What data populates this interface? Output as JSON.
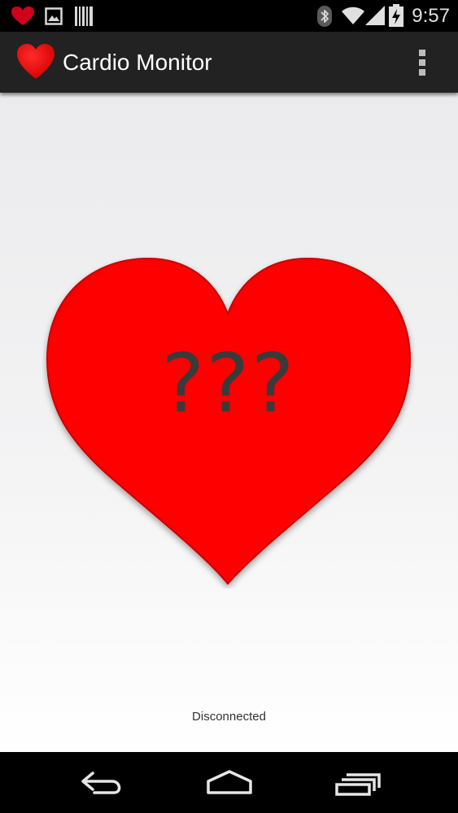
{
  "status_bar": {
    "time": "9:57",
    "notification_icons": [
      "heart-icon",
      "image-icon",
      "barcode-icon"
    ],
    "system_icons": [
      "bluetooth-icon",
      "wifi-icon",
      "signal-icon",
      "battery-charging-icon"
    ]
  },
  "action_bar": {
    "title": "Cardio Monitor",
    "app_icon": "heart-icon",
    "menu_icon": "overflow-menu-icon"
  },
  "main": {
    "heart_rate": "???",
    "status": "Disconnected"
  },
  "nav_bar": {
    "buttons": [
      "back-icon",
      "home-icon",
      "recent-apps-icon"
    ]
  },
  "colors": {
    "heart": "#ff0000",
    "heart_edge": "#cc0000",
    "action_bar": "#222222",
    "status_bar": "#000000",
    "bpm_text": "#3a3a3a"
  }
}
